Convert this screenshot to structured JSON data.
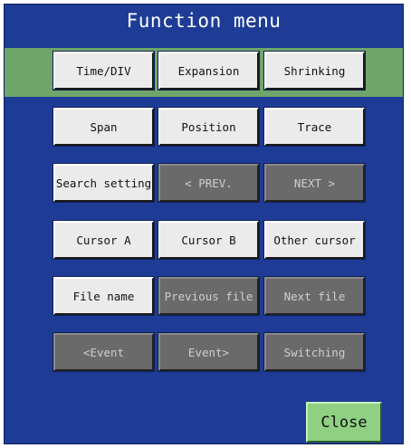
{
  "title": "Function menu",
  "buttons": [
    [
      {
        "label": "Time/DIV",
        "enabled": true
      },
      {
        "label": "Expansion",
        "enabled": true
      },
      {
        "label": "Shrinking",
        "enabled": true
      }
    ],
    [
      {
        "label": "Span",
        "enabled": true
      },
      {
        "label": "Position",
        "enabled": true
      },
      {
        "label": "Trace",
        "enabled": true
      }
    ],
    [
      {
        "label": "Search setting",
        "enabled": true
      },
      {
        "label": "< PREV.",
        "enabled": false
      },
      {
        "label": "NEXT >",
        "enabled": false
      }
    ],
    [
      {
        "label": "Cursor A",
        "enabled": true
      },
      {
        "label": "Cursor B",
        "enabled": true
      },
      {
        "label": "Other cursor",
        "enabled": true
      }
    ],
    [
      {
        "label": "File name",
        "enabled": true
      },
      {
        "label": "Previous file",
        "enabled": false
      },
      {
        "label": "Next file",
        "enabled": false
      }
    ],
    [
      {
        "label": "<Event",
        "enabled": false
      },
      {
        "label": "Event>",
        "enabled": false
      },
      {
        "label": "Switching",
        "enabled": false
      }
    ]
  ],
  "close_label": "Close",
  "colors": {
    "panel_background": "#1e3c96",
    "highlight_bar": "#6fa56a",
    "enabled_button": "#ebebeb",
    "disabled_button": "#6a6a6a",
    "close_button": "#8fd083"
  }
}
